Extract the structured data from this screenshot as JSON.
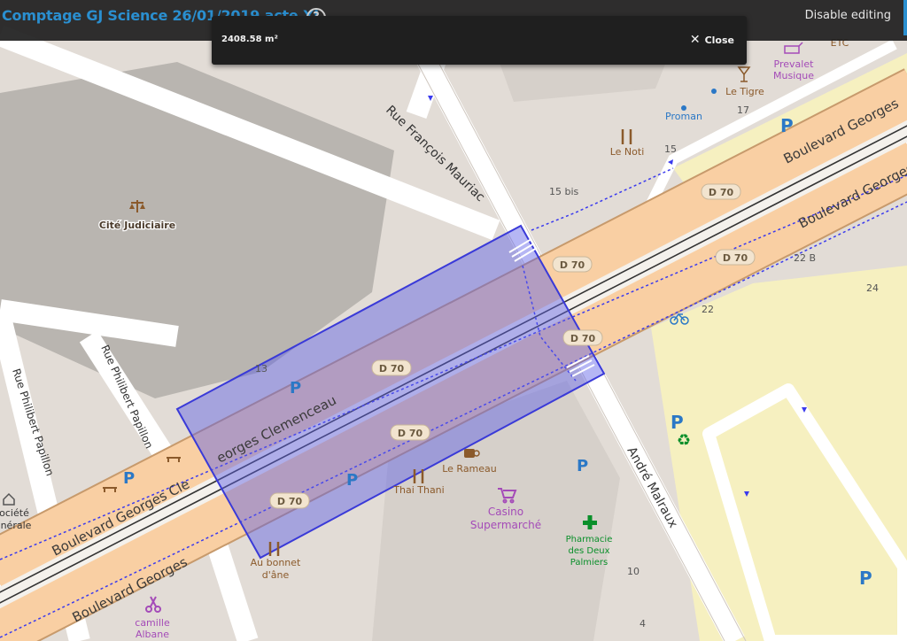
{
  "header": {
    "title": "Comptage GJ Science 26/01/2019 acte XI",
    "help_icon": "?",
    "disable_editing": "Disable editing"
  },
  "popup": {
    "area": "2408.58 m²",
    "close_label": "Close"
  },
  "map": {
    "streets": {
      "francois_mauriac": "Rue François Mauriac",
      "philibert_papillon_1": "Rue Philibert Papillon",
      "philibert_papillon_2": "Rue Philibert Papillon",
      "georges_upper": "Boulevard Georges",
      "georges_lower_right": "Boulevard Georges",
      "georges_cle": "Boulevard Georges Cle",
      "clemenceau": "eorges Clemenceau",
      "georges_bottom": "Boulevard Georges",
      "andre_malraux": "André Malraux"
    },
    "road_refs": [
      "D 70",
      "D 70",
      "D 70",
      "D 70",
      "D 70",
      "D 70",
      "D 70"
    ],
    "pois": {
      "cite_judiciaire": "Cité Judiciaire",
      "prevalet_1": "Prevalet",
      "prevalet_2": "Musique",
      "etc": "ETC",
      "le_tigre": "Le Tigre",
      "proman": "Proman",
      "le_noti": "Le Noti",
      "le_rameau": "Le Rameau",
      "thai_thani": "Thai Thani",
      "casino_1": "Casino",
      "casino_2": "Supermarché",
      "pharmacie_1": "Pharmacie",
      "pharmacie_2": "des Deux",
      "pharmacie_3": "Palmiers",
      "au_bonnet_1": "Au bonnet",
      "au_bonnet_2": "d'âne",
      "camille_1": "camille",
      "camille_2": "Albane",
      "societe_1": "ociété",
      "societe_2": "nérale"
    },
    "house_numbers": [
      "17",
      "15",
      "15 bis",
      "22 B",
      "24",
      "22",
      "13",
      "10",
      "4"
    ],
    "parking": "P",
    "colors": {
      "trunk_road": "#f9cfa3",
      "trunk_casing": "#c79a6c",
      "pedestrian_area": "#f6f0c0",
      "building": "#d6d0ca",
      "large_building": "#b9b5b0",
      "selection_fill": "#5b5ee6",
      "cycleway": "#3a3aee",
      "poi_blue": "#2b78c6",
      "poi_purple": "#a44bb8",
      "poi_brown": "#8b5a2b",
      "poi_green": "#0a8f2a",
      "header_accent": "#2a8fd0"
    }
  }
}
